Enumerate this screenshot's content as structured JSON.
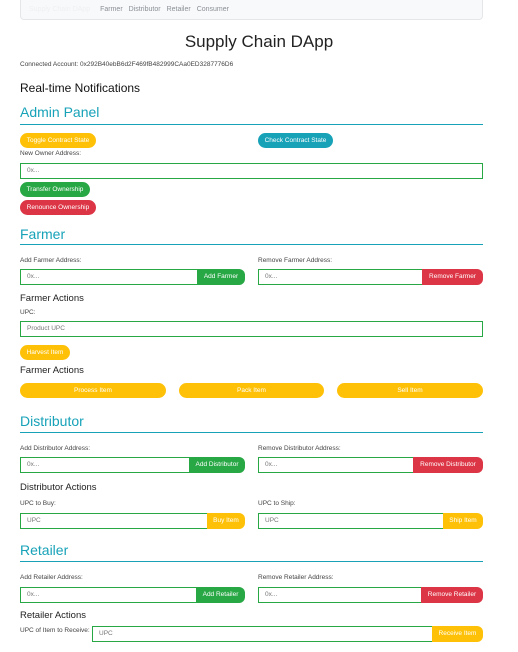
{
  "nav": {
    "brand": "Supply Chain DApp",
    "links": [
      "Farmer",
      "Distributor",
      "Retailer",
      "Consumer"
    ]
  },
  "page_title": "Supply Chain DApp",
  "account": "Connected Account: 0x292B40ebB6d2F469fB482999CAa0ED3287776D6",
  "notifications_title": "Real-time Notifications",
  "admin": {
    "title": "Admin Panel",
    "toggle_label": "Toggle Contract State",
    "check_label": "Check Contract State",
    "new_owner_label": "New Owner Address:",
    "new_owner_placeholder": "0x...",
    "transfer_label": "Transfer Ownership",
    "renounce_label": "Renounce Ownership"
  },
  "farmer": {
    "title": "Farmer",
    "add_label": "Add Farmer Address:",
    "add_placeholder": "0x...",
    "add_button": "Add Farmer",
    "remove_label": "Remove Farmer Address:",
    "remove_placeholder": "0x...",
    "remove_button": "Remove Farmer",
    "actions_title_1": "Farmer Actions",
    "upc_label": "UPC:",
    "upc_placeholder": "Product UPC",
    "harvest_button": "Harvest Item",
    "actions_title_2": "Farmer Actions",
    "process_button": "Process Item",
    "pack_button": "Pack Item",
    "sell_button": "Sell Item"
  },
  "distributor": {
    "title": "Distributor",
    "add_label": "Add Distributor Address:",
    "add_placeholder": "0x...",
    "add_button": "Add Distributor",
    "remove_label": "Remove Distributor Address:",
    "remove_placeholder": "0x...",
    "remove_button": "Remove Distributor",
    "actions_title": "Distributor Actions",
    "buy_label": "UPC to Buy:",
    "buy_placeholder": "UPC",
    "buy_button": "Buy Item",
    "ship_label": "UPC to Ship:",
    "ship_placeholder": "UPC",
    "ship_button": "Ship Item"
  },
  "retailer": {
    "title": "Retailer",
    "add_label": "Add Retailer Address:",
    "add_placeholder": "0x...",
    "add_button": "Add Retailer",
    "remove_label": "Remove Retailer Address:",
    "remove_placeholder": "0x...",
    "remove_button": "Remove Retailer",
    "actions_title": "Retailer Actions",
    "receive_label": "UPC of Item to Receive:",
    "receive_placeholder": "UPC",
    "receive_button": "Receive Item"
  },
  "colors": {
    "teal": "#17a2b8",
    "yellow": "#ffc107",
    "green": "#28a745",
    "red": "#dc3545"
  }
}
